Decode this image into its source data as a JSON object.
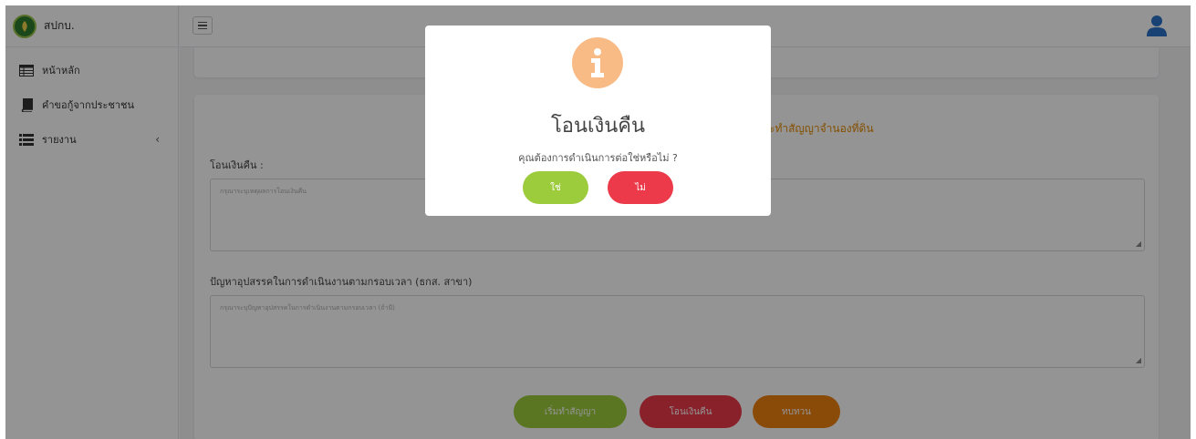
{
  "brand": {
    "name": "สปกบ."
  },
  "sidebar": {
    "items": [
      {
        "label": "หน้าหลัก",
        "icon": "table-icon"
      },
      {
        "label": "คำขอกู้จากประชาชน",
        "icon": "book-icon"
      },
      {
        "label": "รายงาน",
        "icon": "list-icon",
        "chevron": "‹"
      }
    ]
  },
  "main": {
    "card_title": "ะทำสัญญาจำนองที่ดิน",
    "refund_label": "โอนเงินคืน :",
    "refund_placeholder": "กรุณาระบุเหตุผลการโอนเงินคืน",
    "problem_label": "ปัญหาอุปสรรคในการดำเนินงานตามกรอบเวลา (ธกส. สาขา)",
    "problem_placeholder": "กรุณาระบุปัญหาอุปสรรคในการดำเนินงานตามกรอบเวลา (ถ้ามี)",
    "buttons": {
      "contract": "เริ่มทำสัญญา",
      "refund": "โอนเงินคืน",
      "review": "ทบทวน"
    }
  },
  "modal": {
    "title": "โอนเงินคืน",
    "text": "คุณต้องการดำเนินการต่อใช่หรือไม่ ?",
    "confirm": "ใช่",
    "cancel": "ไม่"
  },
  "colors": {
    "accent_orange": "#e68a00",
    "green": "#9ccb3b",
    "red": "#ec3a4a",
    "orange": "#f0820f",
    "info": "#f8bb86",
    "user": "#2b72c8"
  }
}
